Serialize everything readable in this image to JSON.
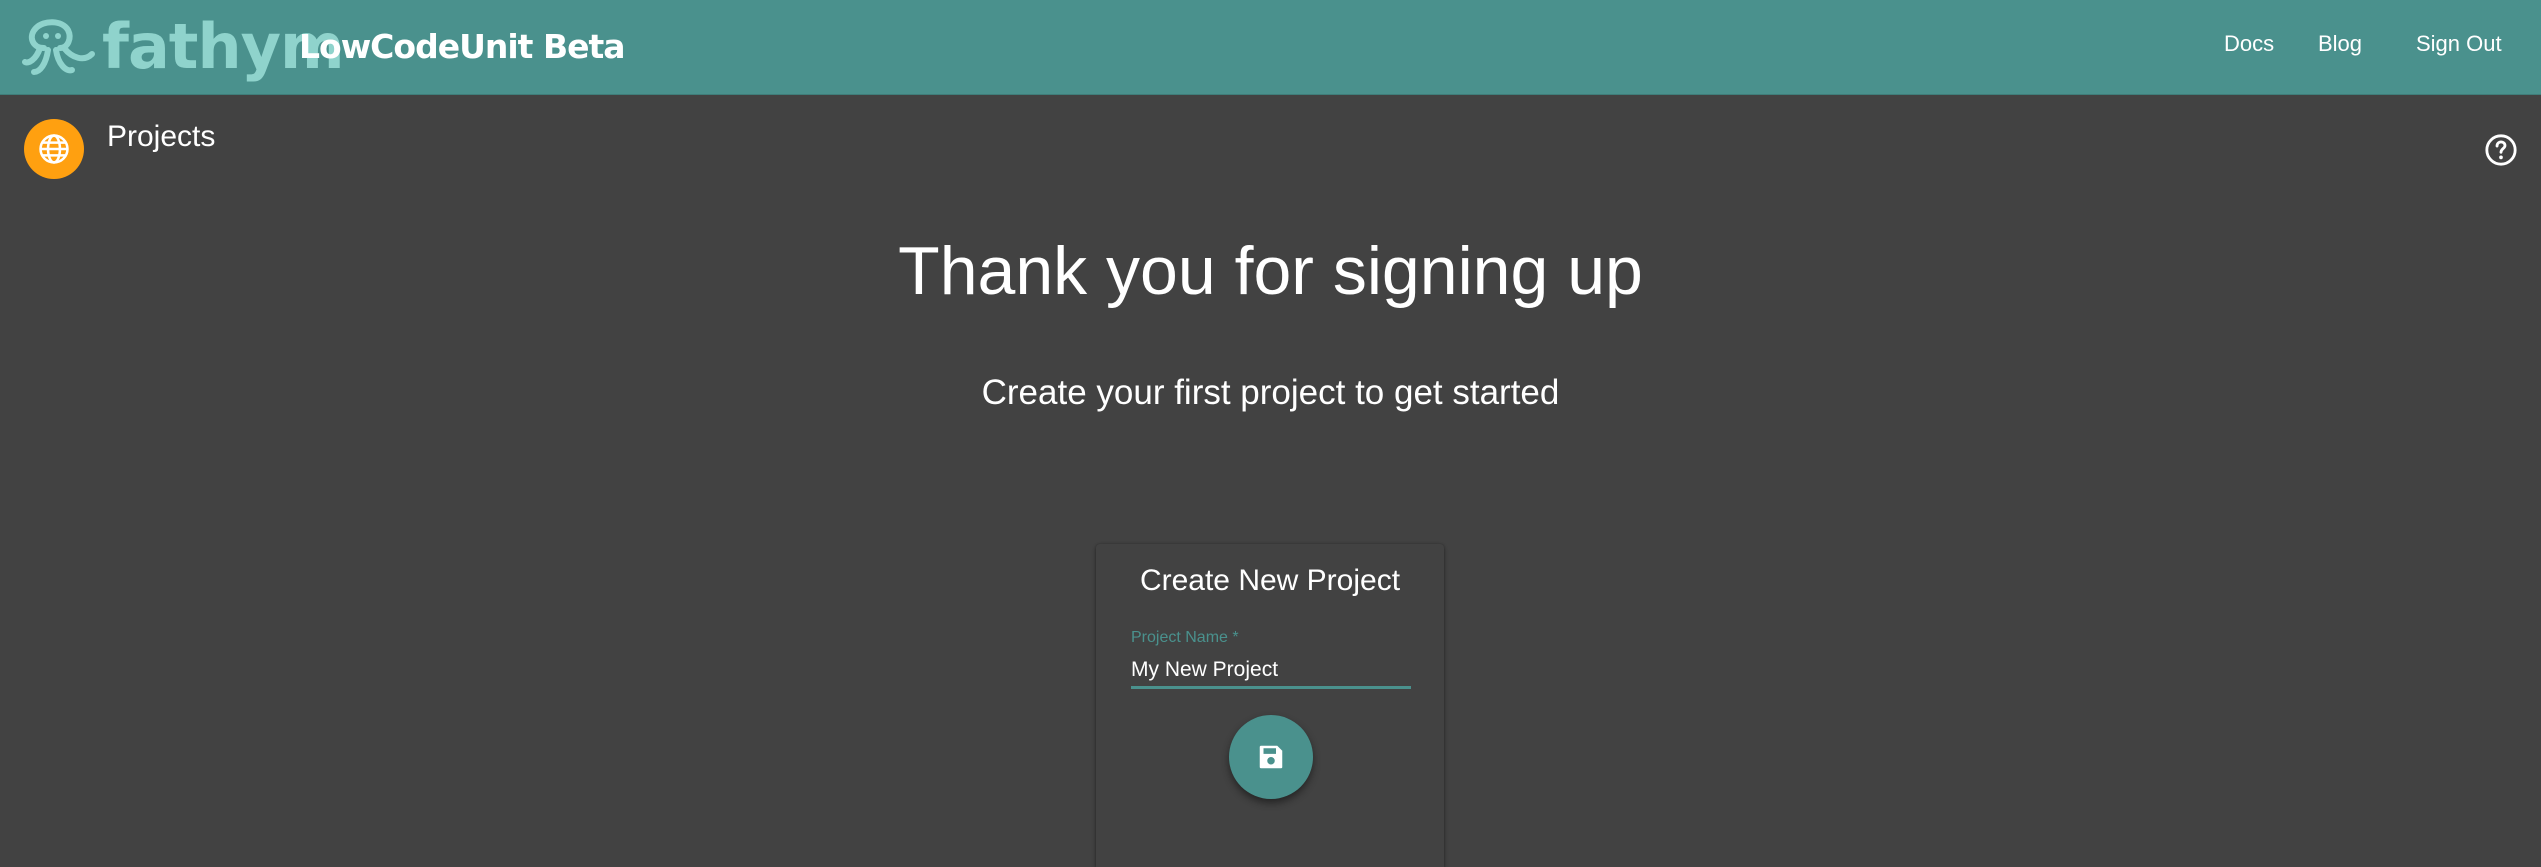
{
  "header": {
    "logo_text": "fathym",
    "app_title": "LowCodeUnit Beta",
    "nav": {
      "docs": "Docs",
      "blog": "Blog",
      "sign_out": "Sign Out"
    }
  },
  "section": {
    "title": "Projects",
    "icon": "globe-icon",
    "help_icon": "help-circle-icon"
  },
  "hero": {
    "title": "Thank you for signing up",
    "subtitle": "Create your first project to get started"
  },
  "new_project_card": {
    "title": "Create New Project",
    "field_label": "Project Name",
    "required_mark": "*",
    "field_value": "My New Project",
    "save_icon": "save-icon"
  },
  "colors": {
    "header_bg": "#4a918d",
    "page_bg": "#424242",
    "accent": "#4a918d",
    "badge": "#ffa010"
  }
}
